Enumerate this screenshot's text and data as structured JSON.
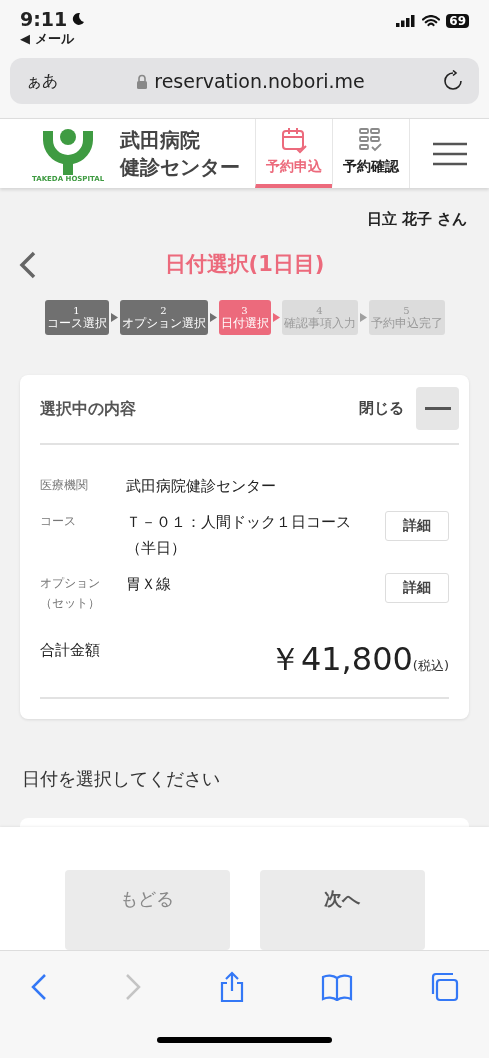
{
  "status_bar": {
    "time": "9:11",
    "back_app": "◀ メール",
    "battery": "69"
  },
  "browser": {
    "text_size": "ぁあ",
    "url": "reservation.nobori.me"
  },
  "header": {
    "logo_caption": "TAKEDA HOSPITAL",
    "site_name": [
      "武田病院",
      "健診センター"
    ],
    "nav": [
      {
        "label": "予約申込",
        "selected": true,
        "kind": "calendar"
      },
      {
        "label": "予約確認",
        "selected": false,
        "kind": "list"
      }
    ]
  },
  "user_name": "日立 花子 さん",
  "page_title": "日付選択(1日目)",
  "steps": [
    {
      "number": "1",
      "label": "コース選択",
      "done": true,
      "selected": false
    },
    {
      "number": "2",
      "label": "オプション選択",
      "done": true,
      "selected": false
    },
    {
      "number": "3",
      "label": "日付選択",
      "done": false,
      "selected": true
    },
    {
      "number": "4",
      "label": "確認事項入力",
      "done": false,
      "selected": false
    },
    {
      "number": "5",
      "label": "予約申込完了",
      "done": false,
      "selected": false
    }
  ],
  "summary": {
    "title": "選択中の内容",
    "close_label": "閉じる",
    "expanded": true,
    "rows": [
      {
        "label": [
          "医療機関"
        ],
        "value": "武田病院健診センター"
      },
      {
        "label": [
          "コース"
        ],
        "value": "Ｔ－０１：人間ドック１日コース（半日）",
        "detail": "詳細"
      },
      {
        "label": [
          "オプション",
          "（セット）"
        ],
        "value": "胃Ｘ線",
        "detail": "詳細"
      }
    ],
    "total_label": "合計金額",
    "total": "￥41,800",
    "tax_note": "(税込)"
  },
  "date_prompt": "日付を選択してください",
  "buttons": [
    {
      "label": "もどる",
      "kind": "back"
    },
    {
      "label": "次へ",
      "kind": "next"
    }
  ]
}
